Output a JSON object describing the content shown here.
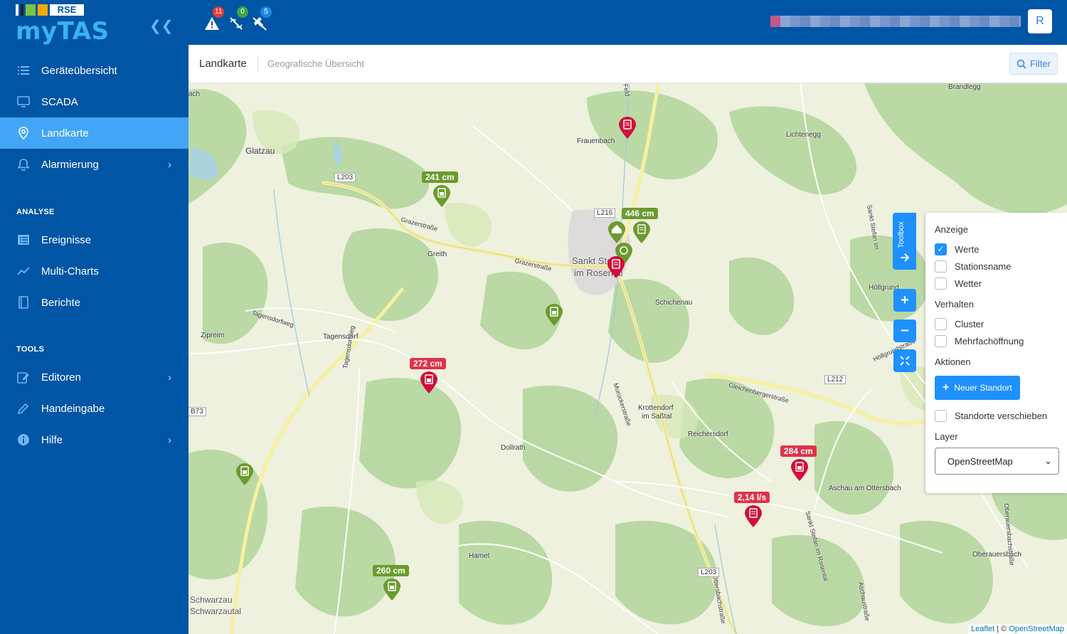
{
  "brand": {
    "name": "myTAS",
    "logo_text": "RSE"
  },
  "sidebar": {
    "items": [
      {
        "label": "Geräteübersicht",
        "icon": "list-icon"
      },
      {
        "label": "SCADA",
        "icon": "monitor-icon"
      },
      {
        "label": "Landkarte",
        "icon": "map-pin-icon",
        "active": true
      },
      {
        "label": "Alarmierung",
        "icon": "bell-icon",
        "has_children": true
      }
    ],
    "section_analyse": "ANALYSE",
    "analyse_items": [
      {
        "label": "Ereignisse",
        "icon": "table-icon"
      },
      {
        "label": "Multi-Charts",
        "icon": "chart-icon"
      },
      {
        "label": "Berichte",
        "icon": "report-icon"
      }
    ],
    "section_tools": "TOOLS",
    "tools_items": [
      {
        "label": "Editoren",
        "icon": "editor-icon",
        "has_children": true
      },
      {
        "label": "Handeingabe",
        "icon": "pencil-icon"
      },
      {
        "label": "Hilfe",
        "icon": "info-icon",
        "has_children": true
      }
    ]
  },
  "topbar": {
    "alerts": [
      {
        "count": "11",
        "color": "#e53935",
        "icon": "warning-icon"
      },
      {
        "count": "0",
        "color": "#43a047",
        "icon": "link-off-icon"
      },
      {
        "count": "5",
        "color": "#1e88e5",
        "icon": "signal-off-icon"
      }
    ],
    "avatar_initial": "R"
  },
  "header": {
    "title": "Landkarte",
    "subtitle": "Geografische Übersicht",
    "filter_label": "Filter"
  },
  "map": {
    "value_labels": [
      {
        "text": "241 cm",
        "status": "ok"
      },
      {
        "text": "446 cm",
        "status": "ok"
      },
      {
        "text": "272 cm",
        "status": "alarm"
      },
      {
        "text": "284 cm",
        "status": "alarm"
      },
      {
        "text": "2,14 l/s",
        "status": "alarm"
      },
      {
        "text": "260 cm",
        "status": "ok"
      }
    ],
    "places": [
      "Brandlegg",
      "Frauenbach",
      "Lichtenegg",
      "Glatzau",
      "Greith",
      "Sankt Stefan",
      "im Rosental",
      "Schichenau",
      "Höllgrund",
      "Zipreim",
      "Tagensdorf",
      "Tagensdorfweg",
      "Grazerstraße",
      "Grazerstraße",
      "Krottendorf",
      "im Saßtal",
      "Reichersdorf",
      "Dollrath",
      "Aschau am Ottersbach",
      "Hamet",
      "Oberauersbach",
      "Schwarzau",
      "Schwarzautal",
      "Gleichenbergerstraße",
      "Höllgrundstraße",
      "Muruckerstraße",
      "Tagensdorfweg",
      "Sankt Stefan im Rosental",
      "Ottersbachstraße",
      "Aschaustraße",
      "Oberauersbachstraße",
      "Feld",
      "ach",
      "Sankt Stefan im"
    ],
    "road_tags": [
      "L203",
      "L216",
      "L212",
      "L203",
      "B73"
    ],
    "toolbox_label": "Toolbox",
    "panel": {
      "anzeige_title": "Anzeige",
      "anzeige_options": [
        {
          "label": "Werte",
          "checked": true
        },
        {
          "label": "Stationsname",
          "checked": false
        },
        {
          "label": "Wetter",
          "checked": false
        }
      ],
      "verhalten_title": "Verhalten",
      "verhalten_options": [
        {
          "label": "Cluster",
          "checked": false
        },
        {
          "label": "Mehrfachöffnung",
          "checked": false
        }
      ],
      "aktionen_title": "Aktionen",
      "new_location_label": "Neuer Standort",
      "move_locations_label": "Standorte verschieben",
      "layer_title": "Layer",
      "layer_value": "OpenStreetMap"
    },
    "attribution": {
      "leaflet": "Leaflet",
      "sep": " | © ",
      "osm": "OpenStreetMap"
    }
  }
}
